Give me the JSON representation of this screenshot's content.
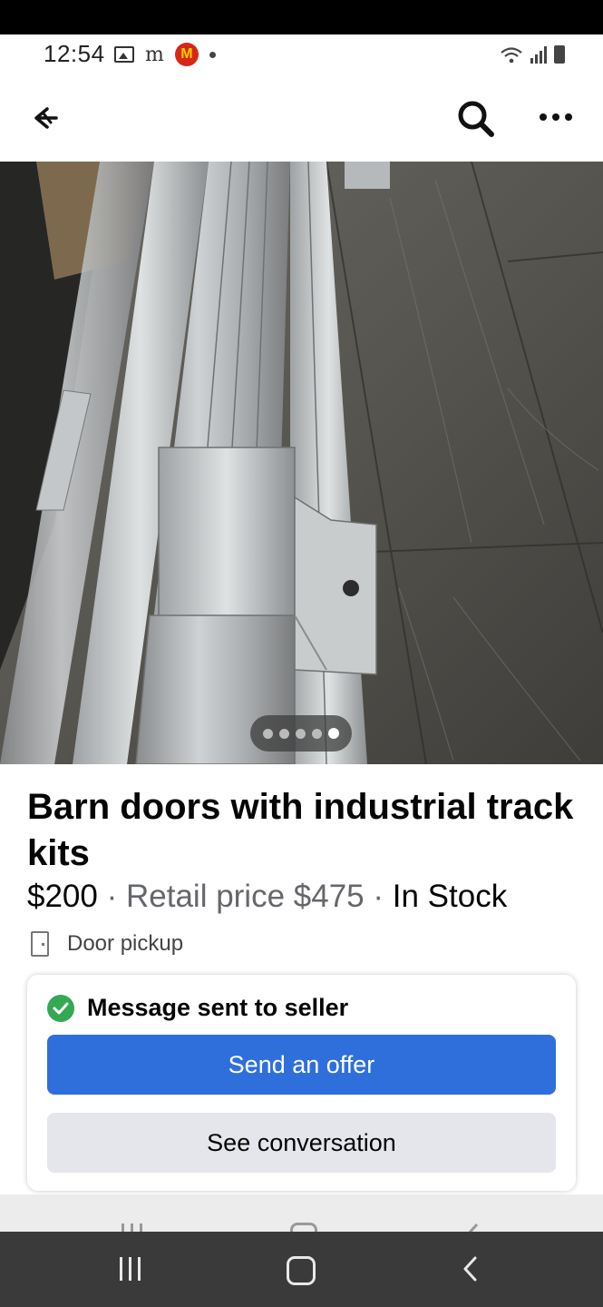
{
  "status_bar": {
    "time": "12:54",
    "left_icons": [
      "image-icon",
      "m-icon",
      "mcdonalds-icon",
      "dot-icon"
    ],
    "mcd_letter": "M",
    "m_letter": "m",
    "right_icons": [
      "wifi-icon",
      "signal-icon",
      "battery-icon"
    ]
  },
  "header": {
    "back_icon": "back-arrow-icon",
    "search_icon": "search-icon",
    "more_icon": "more-icon"
  },
  "photo": {
    "carousel_count": 5,
    "carousel_active_index": 4
  },
  "listing": {
    "title": "Barn doors with industrial track kits",
    "price": "$200",
    "sep1": " · ",
    "retail_text": "Retail price $475",
    "sep2": " · ",
    "stock_text": "In Stock",
    "pickup_label": "Door pickup"
  },
  "message_card": {
    "status_text": "Message sent to seller",
    "offer_button": "Send an offer",
    "conversation_button": "See conversation"
  },
  "colors": {
    "offer_button_bg": "#2f6fdc",
    "conversation_button_bg": "#e4e6eb",
    "check_green": "#35a853",
    "secondary_text": "#65676b"
  },
  "nav_bar": {
    "icons": [
      "recent-apps-icon",
      "home-icon",
      "nav-back-icon"
    ]
  }
}
